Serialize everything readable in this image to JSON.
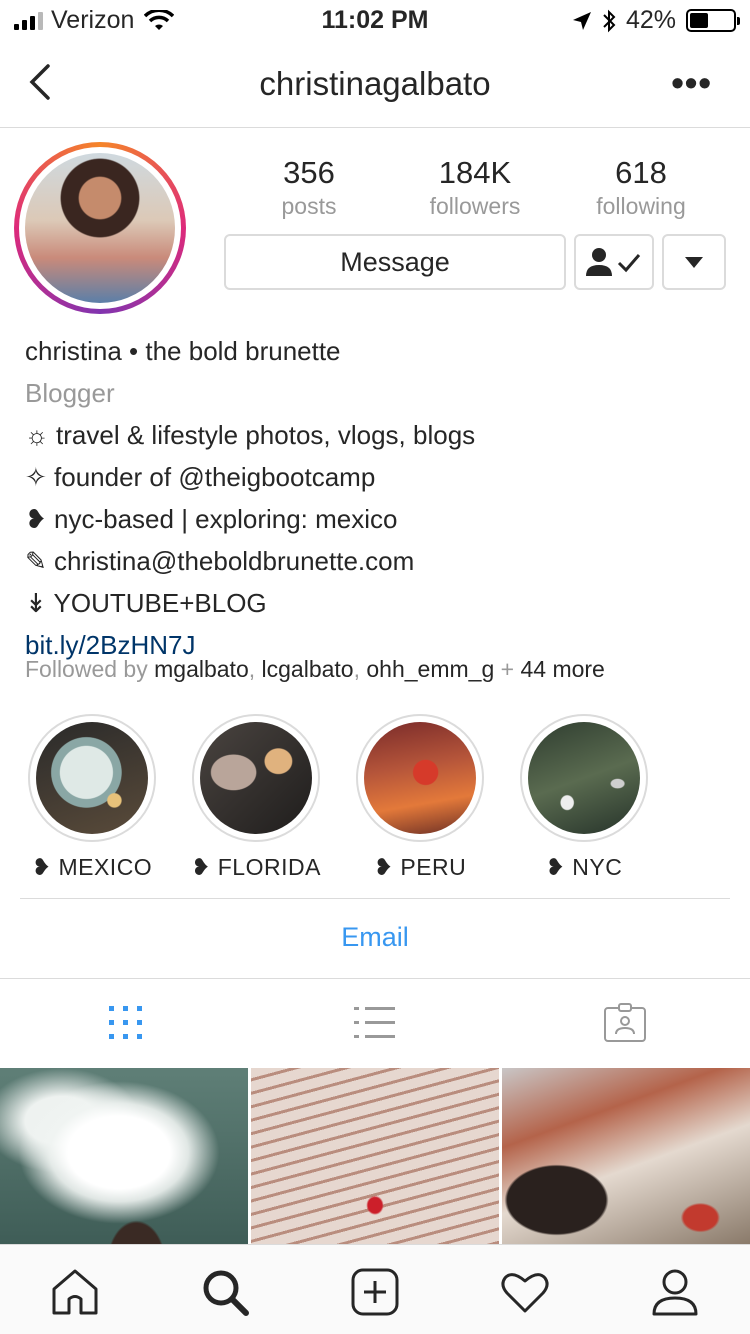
{
  "status_bar": {
    "carrier": "Verizon",
    "time": "11:02 PM",
    "battery": "42%",
    "battery_level": 0.42
  },
  "nav": {
    "username": "christinagalbato",
    "more_label": "•••"
  },
  "profile": {
    "stats": [
      {
        "value": "356",
        "label": "posts"
      },
      {
        "value": "184K",
        "label": "followers"
      },
      {
        "value": "618",
        "label": "following"
      }
    ],
    "message_label": "Message",
    "display_name": "christina • the bold brunette",
    "category": "Blogger",
    "bio_lines": [
      "☼ travel & lifestyle photos, vlogs, blogs",
      "✧ founder of @theigbootcamp",
      "❥ nyc-based | exploring: mexico",
      "✎ christina@theboldbrunette.com",
      "↡ YOUTUBE+BLOG"
    ],
    "link": "bit.ly/2BzHN7J",
    "followed_by": {
      "prefix": "Followed by",
      "users": [
        "mgalbato",
        "lcgalbato",
        "ohh_emm_g"
      ],
      "suffix": "44 more"
    }
  },
  "highlights": [
    {
      "label": "❥  MEXICO"
    },
    {
      "label": "❥  FLORIDA"
    },
    {
      "label": "❥  PERU"
    },
    {
      "label": "❥  NYC"
    }
  ],
  "contact": {
    "email_label": "Email"
  },
  "colors": {
    "accent": "#3897f0",
    "link": "#003569",
    "muted": "#999999",
    "border": "#dbdbdb"
  },
  "icons": {
    "tabs": [
      "grid-icon",
      "list-icon",
      "tagged-icon"
    ],
    "bottom_nav": [
      "home-icon",
      "search-icon",
      "new-post-icon",
      "activity-heart-icon",
      "profile-icon"
    ]
  }
}
